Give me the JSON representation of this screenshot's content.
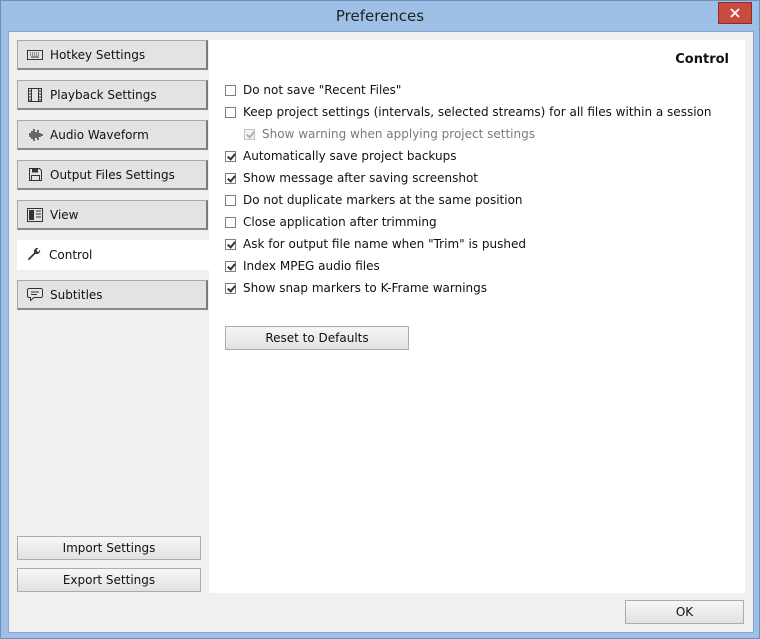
{
  "window": {
    "title": "Preferences"
  },
  "sidebar": {
    "items": [
      {
        "label": "Hotkey Settings",
        "icon": "keyboard-icon",
        "active": false
      },
      {
        "label": "Playback Settings",
        "icon": "film-icon",
        "active": false
      },
      {
        "label": "Audio Waveform",
        "icon": "waveform-icon",
        "active": false
      },
      {
        "label": "Output Files Settings",
        "icon": "floppy-disk-icon",
        "active": false
      },
      {
        "label": "View",
        "icon": "view-icon",
        "active": false
      },
      {
        "label": "Control",
        "icon": "wrench-icon",
        "active": true
      },
      {
        "label": "Subtitles",
        "icon": "speech-bubble-icon",
        "active": false
      }
    ],
    "import_label": "Import Settings",
    "export_label": "Export Settings"
  },
  "panel": {
    "title": "Control",
    "options": [
      {
        "label": "Do not save \"Recent Files\"",
        "checked": false,
        "enabled": true
      },
      {
        "label": "Keep project settings (intervals, selected streams) for all files within a session",
        "checked": false,
        "enabled": true
      },
      {
        "label": "Show warning when applying project settings",
        "checked": true,
        "enabled": false
      },
      {
        "label": "Automatically save project backups",
        "checked": true,
        "enabled": true
      },
      {
        "label": "Show message after saving screenshot",
        "checked": true,
        "enabled": true
      },
      {
        "label": "Do not duplicate markers at the same position",
        "checked": false,
        "enabled": true
      },
      {
        "label": "Close application after trimming",
        "checked": false,
        "enabled": true
      },
      {
        "label": "Ask for output file name when \"Trim\" is pushed",
        "checked": true,
        "enabled": true
      },
      {
        "label": "Index MPEG audio files",
        "checked": true,
        "enabled": true
      },
      {
        "label": "Show snap markers to K-Frame warnings",
        "checked": true,
        "enabled": true
      }
    ],
    "reset_label": "Reset to Defaults"
  },
  "footer": {
    "ok_label": "OK"
  },
  "colors": {
    "titlebar": "#9fc0e6",
    "close_button": "#c94a3f",
    "panel_bg": "#ffffff"
  }
}
